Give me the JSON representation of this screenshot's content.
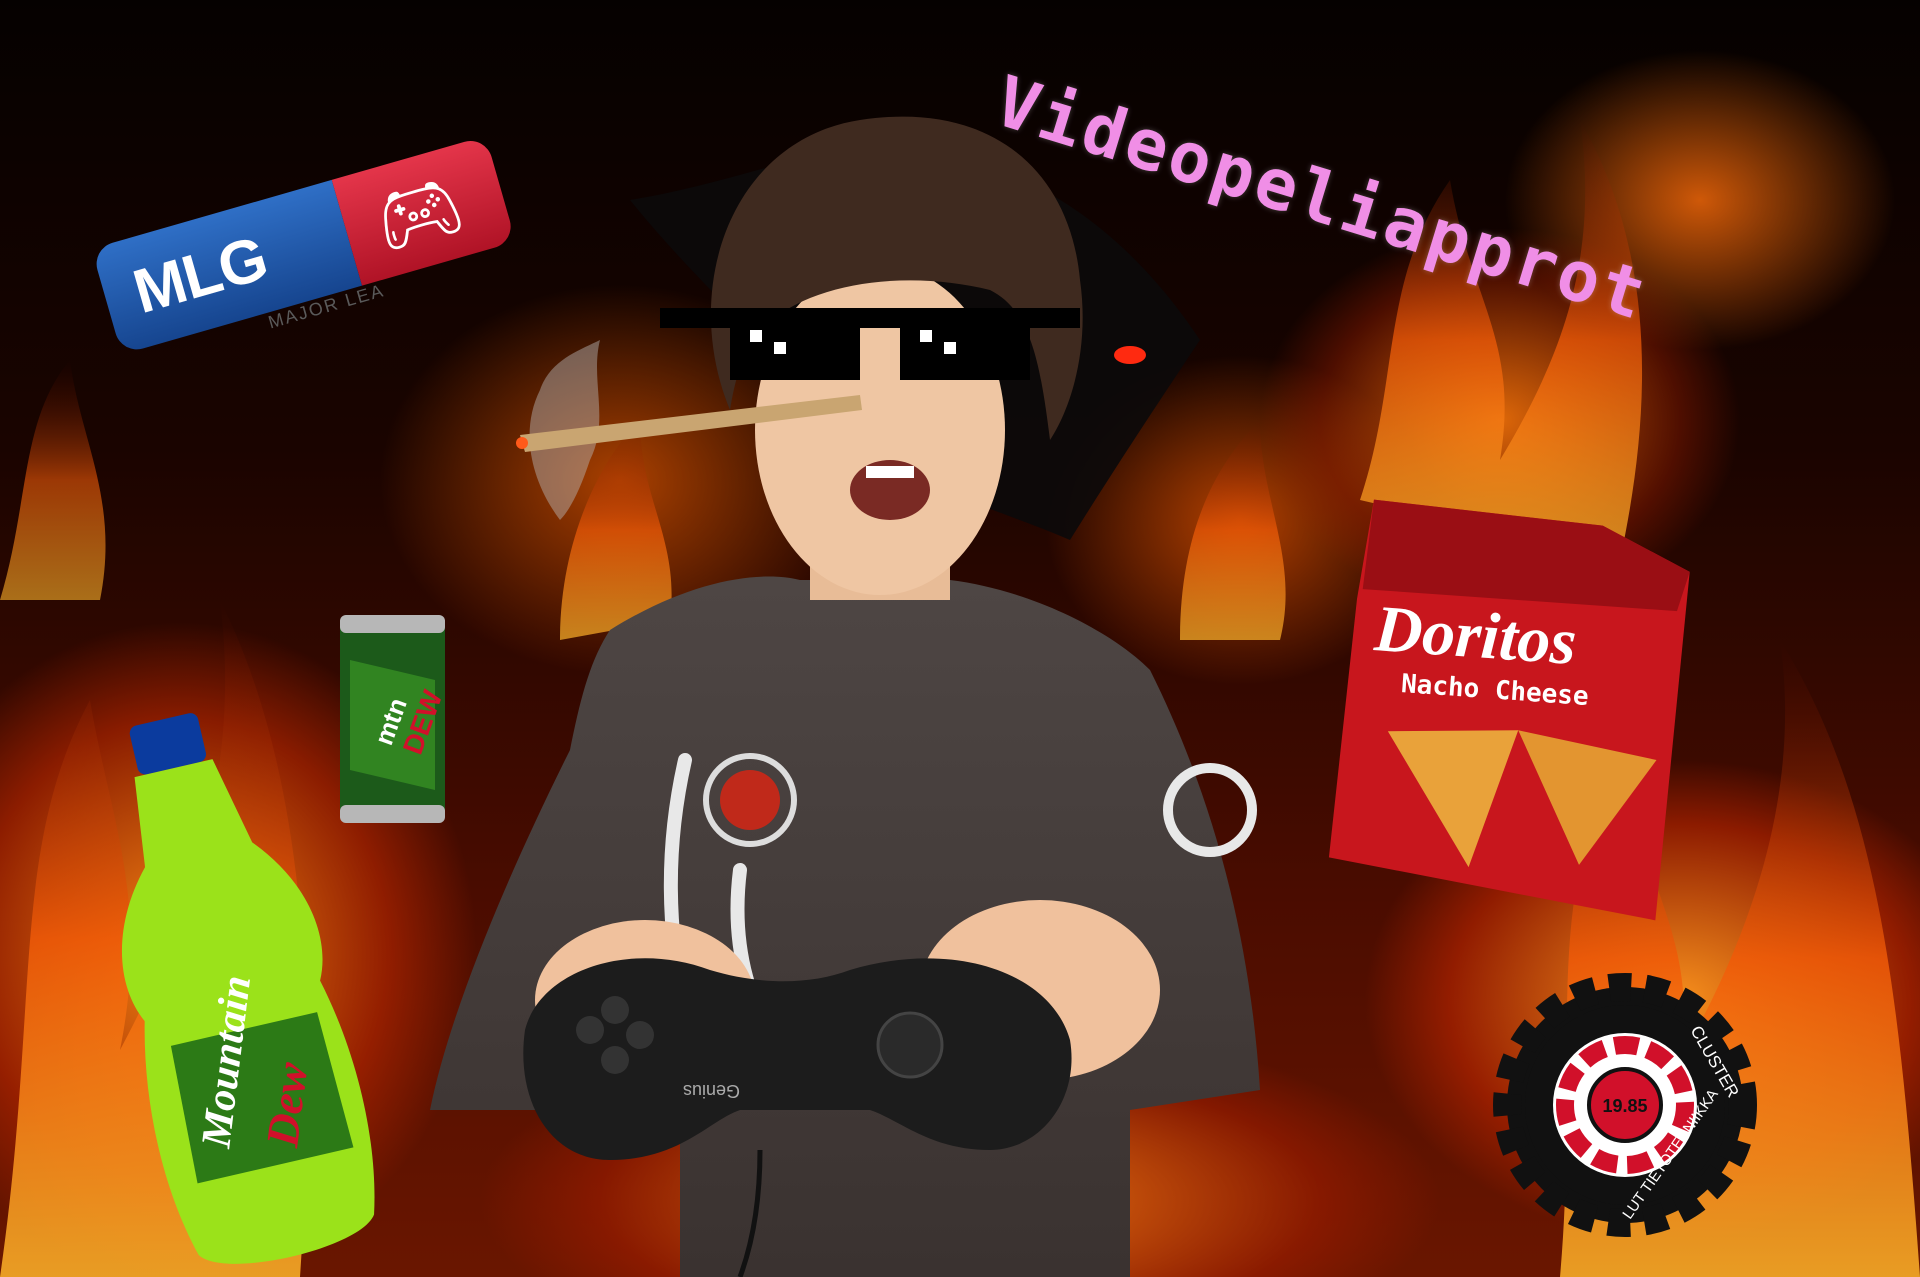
{
  "title": "Videopeliapprot",
  "mlg": {
    "logo_text": "MLG",
    "subtitle": "MAJOR LEA"
  },
  "doritos": {
    "brand": "Doritos",
    "flavor": "Nacho Cheese"
  },
  "cluster": {
    "top_text": "CLUSTER",
    "bottom_text": "LUT TIETOTEKNIIKKA",
    "center": "19.85"
  },
  "bottle": {
    "brand_line1": "Mountain",
    "brand_line2": "Dew"
  },
  "can": {
    "brand_line1": "mtn",
    "brand_line2": "DEW"
  },
  "controller": {
    "brand": "Genius"
  },
  "colors": {
    "title": "#f08ee6",
    "dew_green": "#9be21a",
    "doritos_red": "#c8161d",
    "mlg_blue": "#2f6fc6",
    "mlg_red": "#e4354a"
  }
}
